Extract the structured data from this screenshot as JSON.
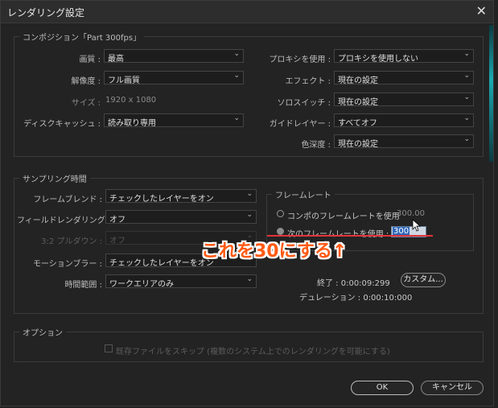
{
  "window": {
    "title": "レンダリング設定",
    "close_icon": "close-icon"
  },
  "comp": {
    "legend": "コンポジション「Part 300fps」",
    "quality": {
      "label": "画質 :",
      "value": "最高"
    },
    "resolution": {
      "label": "解像度 :",
      "value": "フル画質"
    },
    "size": {
      "label": "サイズ :",
      "value": "1920 x 1080"
    },
    "disk_cache": {
      "label": "ディスクキャッシュ :",
      "value": "読み取り専用"
    },
    "proxy": {
      "label": "プロキシを使用 :",
      "value": "プロキシを使用しない"
    },
    "effects": {
      "label": "エフェクト :",
      "value": "現在の設定"
    },
    "solo": {
      "label": "ソロスイッチ :",
      "value": "現在の設定"
    },
    "guide": {
      "label": "ガイドレイヤー :",
      "value": "すべてオフ"
    },
    "color_depth": {
      "label": "色深度 :",
      "value": "現在の設定"
    }
  },
  "sampling": {
    "legend": "サンプリング時間",
    "frame_blend": {
      "label": "フレームブレンド :",
      "value": "チェックしたレイヤーをオン"
    },
    "field_render": {
      "label": "フィールドレンダリング :",
      "value": "オフ"
    },
    "pulldown": {
      "label": "3:2 プルダウン :",
      "value": "オフ"
    },
    "motion_blur": {
      "label": "モーションブラー :",
      "value": "チェックしたレイヤーをオン"
    },
    "time_span": {
      "label": "時間範囲 :",
      "value": "ワークエリアのみ"
    },
    "frame_rate": {
      "legend": "フレームレート",
      "use_comp_label": "コンポのフレームレートを使用",
      "comp_rate": "300.00",
      "use_this_label": "次のフレームレートを使用 :",
      "this_rate": "300"
    },
    "end_label": "終了 : 0:00:09:299",
    "duration_label": "デュレーション : 0:00:10:000",
    "custom_button": "カスタム..."
  },
  "options": {
    "legend": "オプション",
    "skip_existing": "既存ファイルをスキップ (複数のシステム上でのレンダリングを可能にする)"
  },
  "buttons": {
    "ok": "OK",
    "cancel": "キャンセル"
  },
  "annotation": {
    "text": "これを30にする↑",
    "color": "#ff5a14"
  },
  "colors": {
    "background": "#232323",
    "accent": "#1aa9b0",
    "selection": "#2f67b8"
  }
}
